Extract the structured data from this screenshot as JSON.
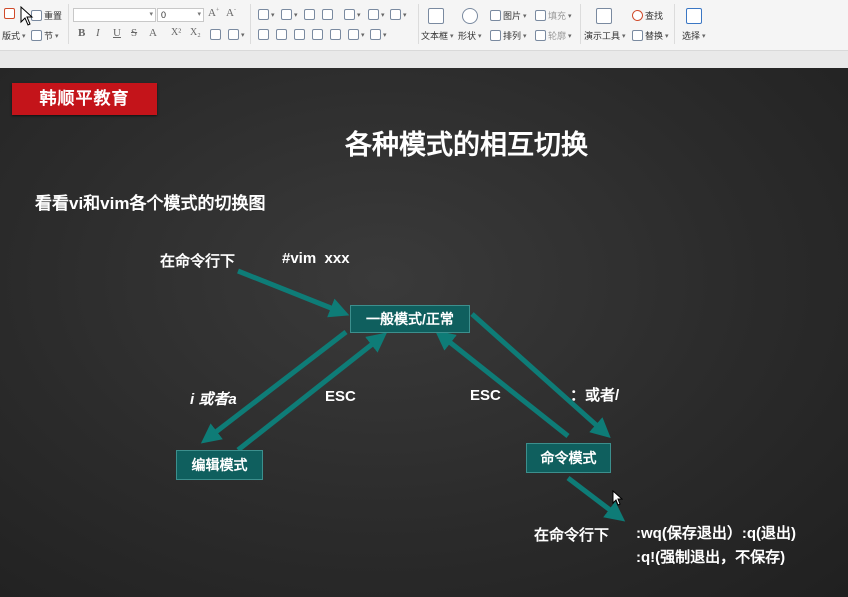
{
  "toolbar": {
    "layout_label": "版式",
    "reset_label": "重置",
    "section_label": "节",
    "font_size_value": "0",
    "format_buttons": [
      "B",
      "I",
      "U",
      "S",
      "A",
      "X²",
      "X₂"
    ],
    "textbox_label": "文本框",
    "shape_label": "形状",
    "picture_label": "图片",
    "fill_label": "填充",
    "arrange_label": "排列",
    "outline_label": "轮廓",
    "presentation_tools_label": "演示工具",
    "find_label": "查找",
    "replace_label": "替换",
    "select_label": "选择"
  },
  "slide": {
    "brand": "韩顺平教育",
    "title": "各种模式的相互切换",
    "subtitle": "看看vi和vim各个模式的切换图",
    "labels": {
      "cmdline_top": "在命令行下",
      "vim_cmd": "#vim  xxx",
      "i_or_a": "i 或者a",
      "esc_left": "ESC",
      "esc_right": "ESC",
      "colon_or_slash": "：或者/",
      "cmdline_bottom": "在命令行下",
      "save_quit": ":wq(保存退出）:q(退出)",
      "force_quit": ":q!(强制退出，不保存)"
    },
    "modes": {
      "normal": "一般模式/正常",
      "edit": "编辑模式",
      "command": "命令模式"
    },
    "colors": {
      "arrow": "#0e7c77",
      "mode_box": "#0f5f5e",
      "brand_bg": "#c4141a",
      "board": "#2b2b2b"
    }
  }
}
